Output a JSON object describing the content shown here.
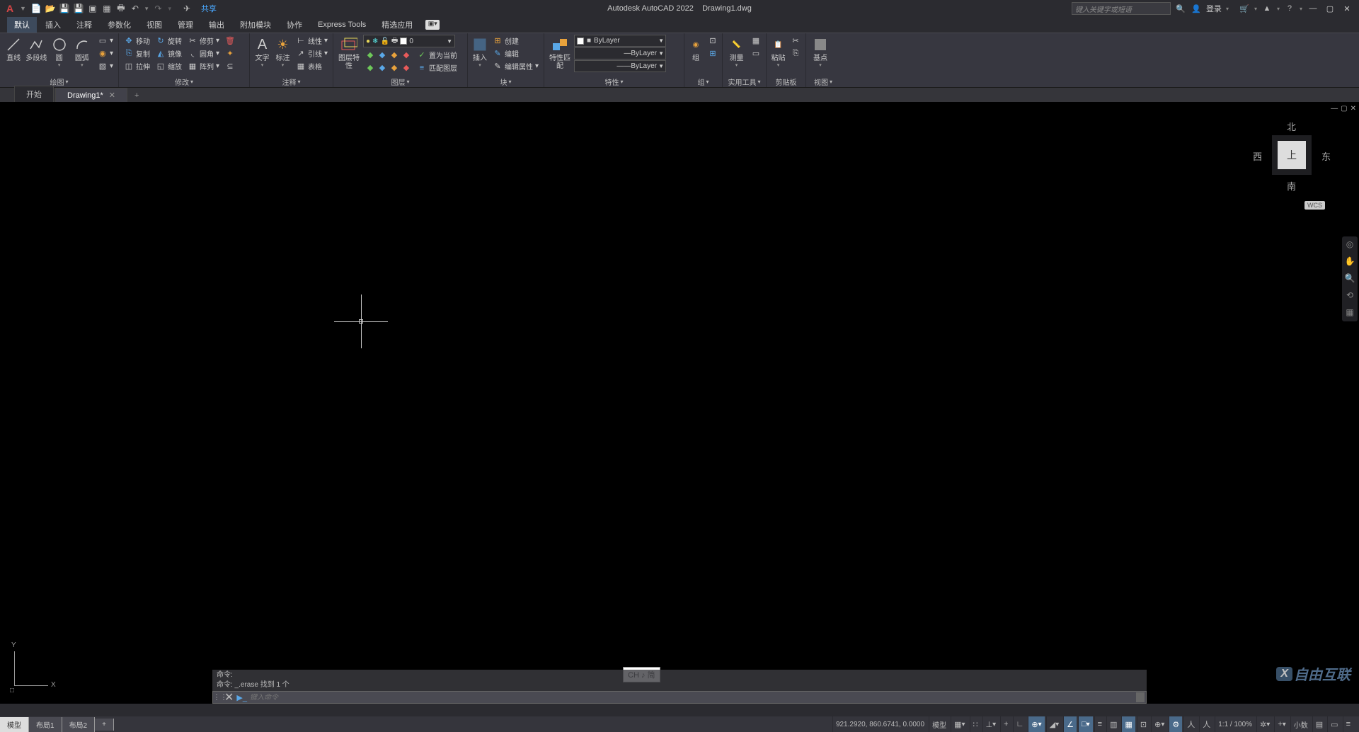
{
  "title": {
    "app": "Autodesk AutoCAD 2022",
    "file": "Drawing1.dwg"
  },
  "qat": {
    "share": "共享"
  },
  "search": {
    "placeholder": "键入关键字或短语"
  },
  "login": "登录",
  "menus": [
    "默认",
    "插入",
    "注释",
    "参数化",
    "视图",
    "管理",
    "输出",
    "附加模块",
    "协作",
    "Express Tools",
    "精选应用"
  ],
  "ribbon": {
    "draw": {
      "title": "绘图",
      "line": "直线",
      "pline": "多段线",
      "circle": "圆",
      "arc": "圆弧"
    },
    "modify": {
      "title": "修改",
      "move": "移动",
      "rotate": "旋转",
      "trim": "修剪",
      "copy": "复制",
      "mirror": "镜像",
      "fillet": "圆角",
      "stretch": "拉伸",
      "scale": "缩放",
      "array": "阵列"
    },
    "annot": {
      "title": "注释",
      "text": "文字",
      "dim": "标注",
      "leader": "引线",
      "table": "表格",
      "linear": "线性"
    },
    "layer": {
      "title": "图层",
      "mgr": "图层特性",
      "current": "0",
      "setcur": "置为当前",
      "match": "匹配图层"
    },
    "block": {
      "title": "块",
      "insert": "插入",
      "create": "创建",
      "edit": "编辑",
      "attr": "编辑属性"
    },
    "props": {
      "title": "特性",
      "match": "特性匹配",
      "bylayer": "ByLayer"
    },
    "group": {
      "title": "组",
      "group": "组"
    },
    "util": {
      "title": "实用工具",
      "measure": "测量"
    },
    "clip": {
      "title": "剪贴板",
      "paste": "粘贴"
    },
    "view": {
      "title": "视图",
      "base": "基点"
    }
  },
  "tabs": {
    "start": "开始",
    "drawing": "Drawing1*"
  },
  "viewcube": {
    "top": "上",
    "n": "北",
    "s": "南",
    "e": "东",
    "w": "西",
    "wcs": "WCS"
  },
  "ucs": {
    "x": "X",
    "y": "Y"
  },
  "ime": "CH ♪ 简",
  "cmd": {
    "l1": "命令:",
    "l2": "命令: _.erase 找到 1 个",
    "placeholder": "键入命令"
  },
  "layouts": {
    "model": "模型",
    "l1": "布局1",
    "l2": "布局2"
  },
  "status": {
    "coords": "921.2920, 860.6741, 0.0000",
    "model": "模型",
    "scale": "1:1 / 100%",
    "dec": "小数"
  },
  "watermark": "自由互联"
}
